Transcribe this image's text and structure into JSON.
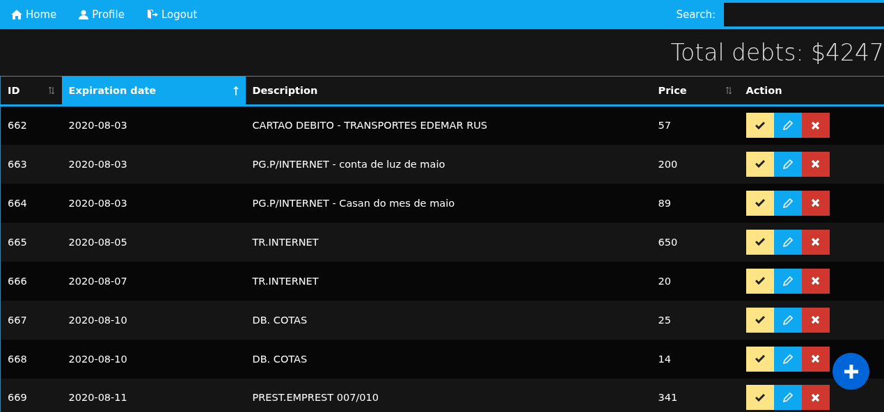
{
  "nav": {
    "links": [
      {
        "kind": "home",
        "label": "Home"
      },
      {
        "kind": "profile",
        "label": "Profile"
      },
      {
        "kind": "logout",
        "label": "Logout"
      }
    ],
    "search": {
      "label": "Search:"
    }
  },
  "total": "Total debts: $4247",
  "table": {
    "columns": [
      {
        "label": "ID",
        "sortable": true,
        "sorted": false,
        "selected": false
      },
      {
        "label": "Expiration date",
        "sortable": true,
        "sorted": true,
        "selected": true
      },
      {
        "label": "Description",
        "sortable": false,
        "selected": false
      },
      {
        "label": "Price",
        "sortable": true,
        "sorted": false,
        "selected": false
      },
      {
        "label": "Action",
        "sortable": false,
        "selected": false
      }
    ],
    "rows": [
      {
        "id": "662",
        "date": "2020-08-03",
        "description": "CARTAO DEBITO - TRANSPORTES EDEMAR RUS",
        "price": "57"
      },
      {
        "id": "663",
        "date": "2020-08-03",
        "description": "PG.P/INTERNET - conta de luz de maio",
        "price": "200"
      },
      {
        "id": "664",
        "date": "2020-08-03",
        "description": "PG.P/INTERNET - Casan do mes de maio",
        "price": "89"
      },
      {
        "id": "665",
        "date": "2020-08-05",
        "description": "TR.INTERNET",
        "price": "650"
      },
      {
        "id": "666",
        "date": "2020-08-07",
        "description": "TR.INTERNET",
        "price": "20"
      },
      {
        "id": "667",
        "date": "2020-08-10",
        "description": "DB. COTAS",
        "price": "25"
      },
      {
        "id": "668",
        "date": "2020-08-10",
        "description": "DB. COTAS",
        "price": "14"
      },
      {
        "id": "669",
        "date": "2020-08-11",
        "description": "PREST.EMPREST 007/010",
        "price": "341"
      }
    ]
  }
}
